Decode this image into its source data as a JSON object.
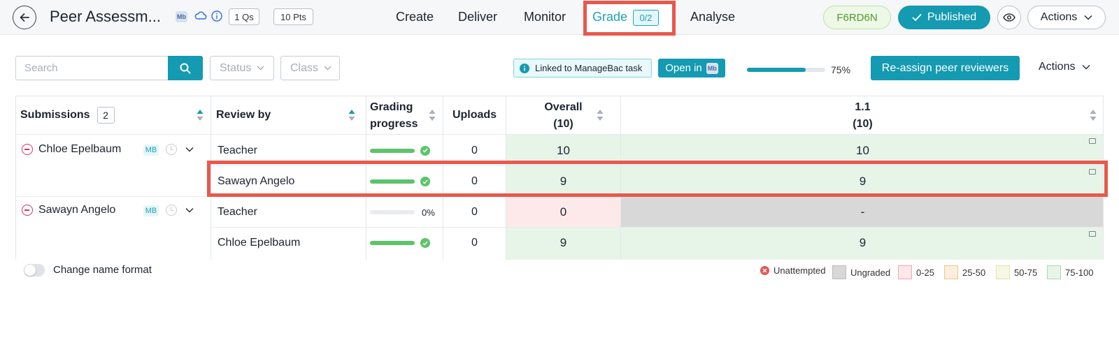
{
  "header": {
    "title": "Peer Assessm...",
    "mb_badge": "Mb",
    "questions_pill": "1 Qs",
    "points_pill": "10 Pts",
    "nav": [
      {
        "label": "Create"
      },
      {
        "label": "Deliver"
      },
      {
        "label": "Monitor"
      },
      {
        "label": "Grade",
        "count": "0/2",
        "active": true
      },
      {
        "label": "Analyse"
      }
    ],
    "class_code": "F6RD6N",
    "published_label": "Published",
    "actions_label": "Actions"
  },
  "toolbar": {
    "search_placeholder": "Search",
    "status_filter": "Status",
    "class_filter": "Class",
    "linked_label": "Linked to ManageBac task",
    "open_in_label": "Open in",
    "open_in_badge": "Mb",
    "progress_percent": 75,
    "progress_label": "75%",
    "reassign_label": "Re-assign peer reviewers",
    "actions_label": "Actions"
  },
  "table": {
    "headers": {
      "submissions": "Submissions",
      "submissions_count": "2",
      "review_by": "Review by",
      "grading_progress_1": "Grading",
      "grading_progress_2": "progress",
      "uploads": "Uploads",
      "overall_1": "Overall",
      "overall_2": "(10)",
      "q1_1": "1.1",
      "q1_2": "(10)"
    },
    "students": [
      {
        "name": "Chloe Epelbaum",
        "tag": "MB"
      },
      {
        "name": "Sawayn Angelo",
        "tag": "MB"
      }
    ],
    "rows": [
      {
        "reviewer": "Teacher",
        "progress": 100,
        "progress_label": "",
        "uploads": "0",
        "overall": "10",
        "q1": "10",
        "band": "green"
      },
      {
        "reviewer": "Sawayn Angelo",
        "progress": 100,
        "progress_label": "",
        "uploads": "0",
        "overall": "9",
        "q1": "9",
        "band": "green"
      },
      {
        "reviewer": "Teacher",
        "progress": 0,
        "progress_label": "0%",
        "uploads": "0",
        "overall": "0",
        "q1": "-",
        "band": "pink"
      },
      {
        "reviewer": "Chloe Epelbaum",
        "progress": 100,
        "progress_label": "",
        "uploads": "0",
        "overall": "9",
        "q1": "9",
        "band": "green"
      }
    ]
  },
  "footer": {
    "toggle_label": "Change name format",
    "legend": [
      {
        "label": "Unattempted"
      },
      {
        "label": "Ungraded"
      },
      {
        "label": "0-25"
      },
      {
        "label": "25-50"
      },
      {
        "label": "50-75"
      },
      {
        "label": "75-100"
      }
    ]
  },
  "colors": {
    "accent": "#149ab1",
    "grade_highlight": "#e8594d",
    "score_green": "#e6f5e8",
    "score_pink": "#fde9ea",
    "ungraded_grey": "#d8d8d8"
  }
}
